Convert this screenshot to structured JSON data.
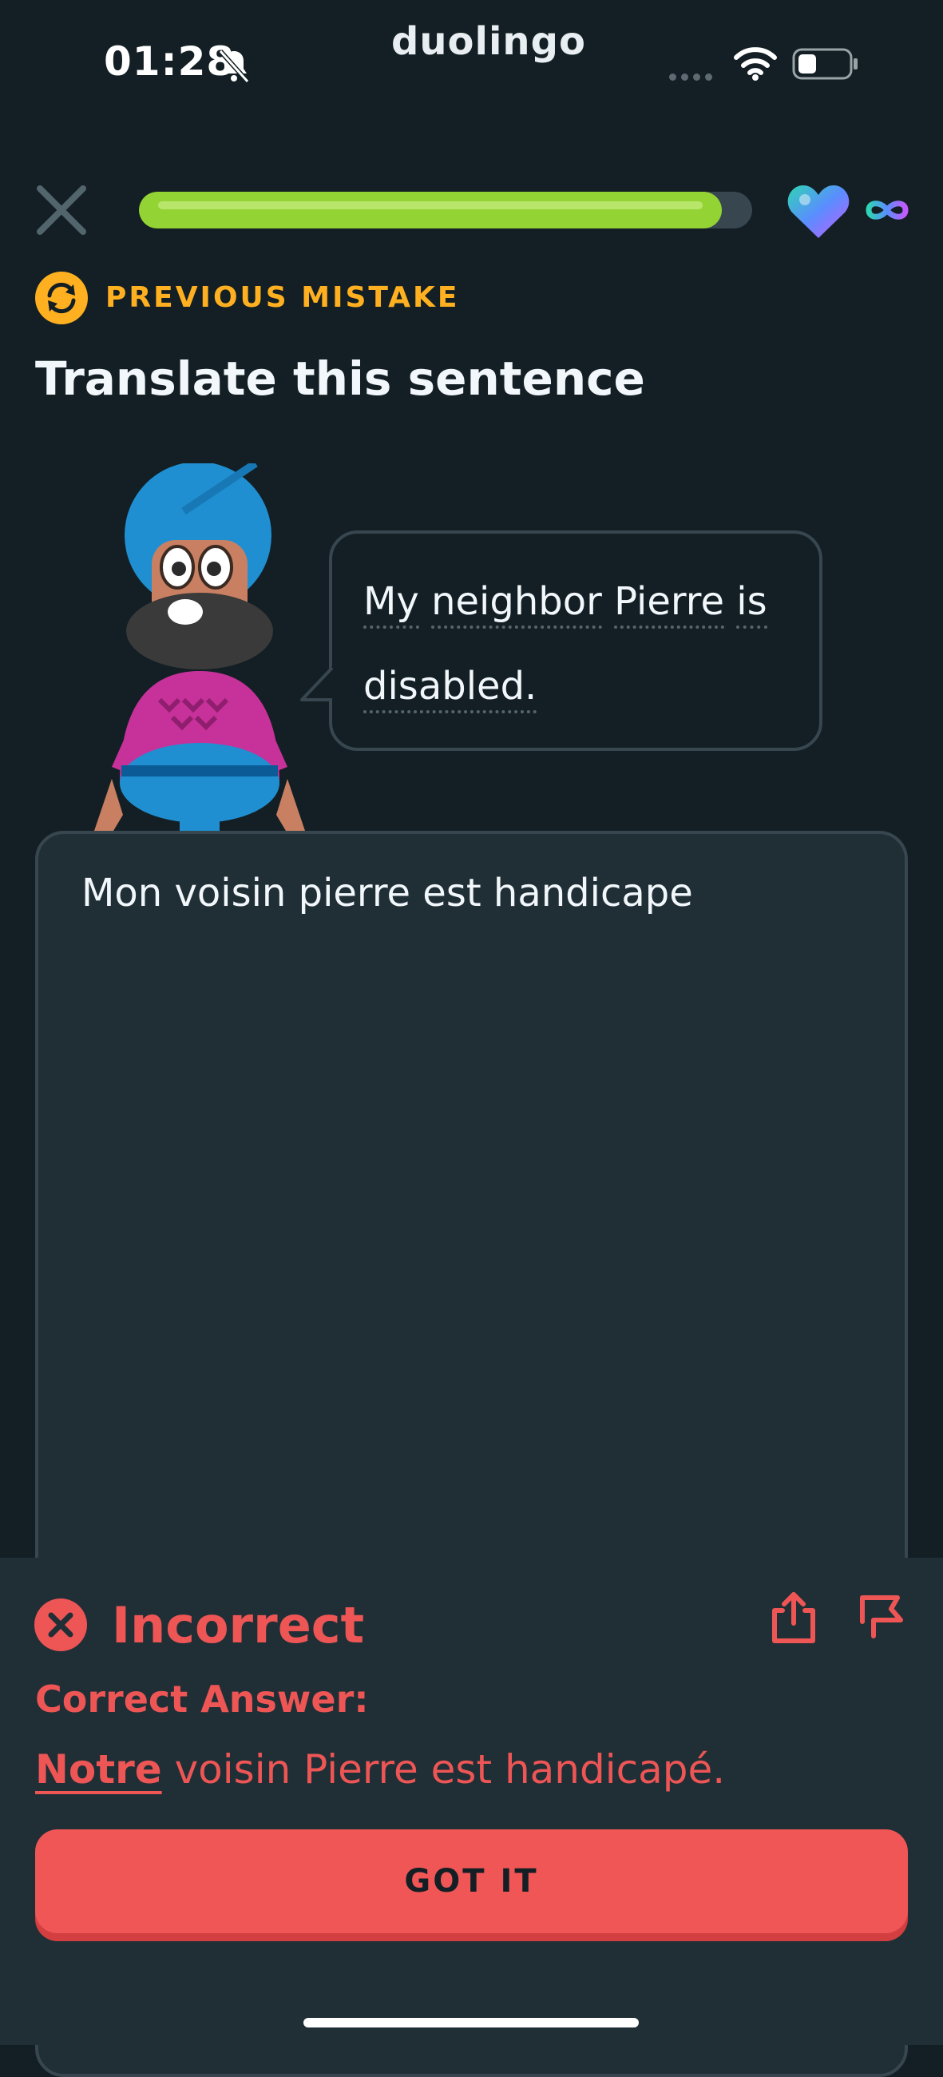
{
  "status_bar": {
    "time": "01:28",
    "brand": "duolingo",
    "icons": [
      "bell-muted-icon",
      "signal-dots-icon",
      "wifi-icon",
      "battery-icon"
    ]
  },
  "header": {
    "progress": 0.95,
    "hearts": "∞",
    "icons": [
      "close-icon",
      "heart-icon",
      "infinity-icon"
    ]
  },
  "lesson": {
    "tag": "PREVIOUS MISTAKE",
    "prompt": "Translate this sentence",
    "sentence_words": [
      "My",
      "neighbor",
      "Pierre",
      "is",
      "disabled."
    ]
  },
  "answer": {
    "text": "Mon voisin pierre est handicape"
  },
  "feedback": {
    "status": "Incorrect",
    "correct_label": "Correct Answer:",
    "correct_highlight": "Notre",
    "correct_rest": " voisin Pierre est handicapé.",
    "button": "GOT IT"
  },
  "colors": {
    "background": "#131f24",
    "progress": "#93d333",
    "mistake": "#ffb020",
    "error": "#ee5555",
    "button": "#f15656"
  }
}
